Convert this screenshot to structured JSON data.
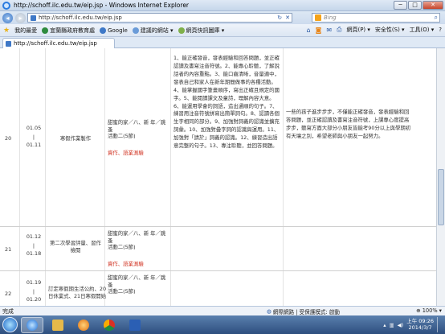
{
  "window": {
    "title": "http://schoff.ilc.edu.tw/eip.jsp - Windows Internet Explorer",
    "min_label": "─",
    "max_label": "□",
    "close_label": "✕"
  },
  "nav": {
    "url": "http://schoff.ilc.edu.tw/eip.jsp",
    "search_placeholder": "Bing"
  },
  "favorites": {
    "label": "我的最愛",
    "items": [
      {
        "label": "宜蘭縣政府教育處"
      },
      {
        "label": "Google"
      },
      {
        "label": "建議的網站 ▾"
      },
      {
        "label": "網頁快訊圖庫 ▾"
      }
    ],
    "tools": [
      {
        "label": "網頁(P) ▾"
      },
      {
        "label": "安全性(S) ▾"
      },
      {
        "label": "工具(O) ▾"
      },
      {
        "label": "?"
      }
    ]
  },
  "tab": {
    "title": "http://schoff.ilc.edu.tw/eip.jsp"
  },
  "table": {
    "rows": [
      {
        "week": "20",
        "date_from": "01.05",
        "tilde": "|",
        "date_to": "01.11",
        "event": "寒假作業製作",
        "lesson_title": "甜蜜的家／八、新 年／跳蚤",
        "lesson_sub": "活動二(5節)",
        "lesson_tag": "資作、語業測驗",
        "goals": "1、能正確發音，發表經驗和回答問題，並正確認讀及書寫注音符號。2、能專心聆聽，了解說話者的內容重點。3、能口齒清晰，音量適中，發表自己和家人在新年期間做事的各種活動。4、能掌握國字筆畫順序，寫出正確且規定的國字。5、能閱讀課文及童詩，理解內容大意。6、能運用學會的詞語，造出通順的句子。7、練習用注音符號拼寫出簡單詞句。8、認讀各個生字相同的部分。9、加強對詞義的認識並擴充詞彙。10、加強對疊字詞的認識與運用。11、加強對「請於」詞義的認識。12、練習造出語意完整的句子。13、專注聆聽，並回答問題。",
        "notes": "一些的孩子進步步步，不僅能正確發音，發表經驗和回答問題，並正確認讀及書寫注音符號，上課專心度提高步步，聽寫方面大部分小朋友皆能考90分以上與學期初有天壤之別，希望老師與小朋友一起努力。"
      },
      {
        "week": "21",
        "date_from": "01.12",
        "tilde": "|",
        "date_to": "01.18",
        "event": "第二次學習評量、習作檢閱",
        "lesson_title": "甜蜜的家／八、新 年／跳蚤",
        "lesson_sub": "活動二(5節)",
        "lesson_tag": "資作、語業測驗",
        "goals": "",
        "notes": ""
      },
      {
        "week": "22",
        "date_from": "01.19",
        "tilde": "|",
        "date_to": "01.20",
        "event": "訂定寒假期生活公約、20日休業式、21日寒假開始",
        "lesson_title": "甜蜜的家／八、新 年／跳蚤",
        "lesson_sub": "活動二(5節)",
        "lesson_tag": "",
        "goals": "",
        "notes": ""
      }
    ]
  },
  "status": {
    "left": "完成",
    "zone": "網際網路 | 受保護模式: 啟動",
    "zoom": "⊕ 100% ▾"
  },
  "taskbar": {
    "time": "上午 09:26",
    "date": "2014/3/7"
  },
  "colors": {
    "accent": "#2b5aa5",
    "red_tag": "#d0301f"
  }
}
